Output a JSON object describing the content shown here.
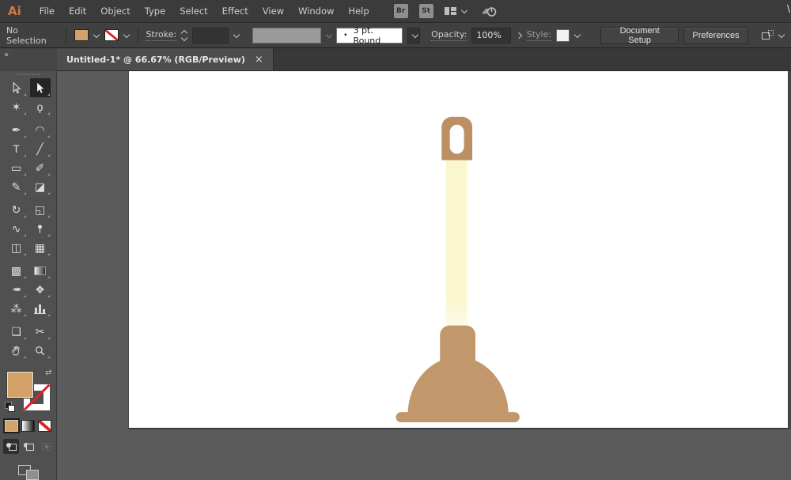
{
  "menu_bar": {
    "logo": "Ai",
    "items": [
      "File",
      "Edit",
      "Object",
      "Type",
      "Select",
      "Effect",
      "View",
      "Window",
      "Help"
    ],
    "bridge_button": "Br",
    "stock_button": "St",
    "cutoff_glyph": "\\"
  },
  "control_bar": {
    "selection_status": "No Selection",
    "fill_color": "#D2A269",
    "stroke_label": "Stroke:",
    "brush_dot": "•",
    "brush_definition": "3 pt. Round",
    "opacity_label": "Opacity:",
    "opacity_value": "100%",
    "style_label": "Style:",
    "document_setup_button": "Document Setup",
    "preferences_button": "Preferences"
  },
  "tab_bar": {
    "tab_title": "Untitled-1* @ 66.67% (RGB/Preview)",
    "close_glyph": "×"
  },
  "toolbar": {
    "collapse_glyph": "«",
    "swap_glyph": "⇄",
    "fill_color": "#D2A269",
    "stroke_style": "none",
    "tool_groups": [
      [
        {
          "name": "selection-tool",
          "icon": "arrow-outline"
        },
        {
          "name": "direct-selection-tool",
          "icon": "arrow-filled",
          "active": true
        },
        {
          "name": "magic-wand-tool",
          "glyph": "✶"
        },
        {
          "name": "lasso-tool",
          "glyph": "ϙ"
        }
      ],
      [
        {
          "name": "pen-tool",
          "glyph": "✒"
        },
        {
          "name": "curvature-tool",
          "glyph": "◠"
        },
        {
          "name": "type-tool",
          "glyph": "T"
        },
        {
          "name": "line-segment-tool",
          "glyph": "╱"
        },
        {
          "name": "rectangle-tool",
          "glyph": "▭"
        },
        {
          "name": "paintbrush-tool",
          "glyph": "✐"
        },
        {
          "name": "shaper-tool",
          "glyph": "✎"
        },
        {
          "name": "eraser-tool",
          "glyph": "◪"
        }
      ],
      [
        {
          "name": "rotate-tool",
          "glyph": "↻"
        },
        {
          "name": "scale-tool",
          "glyph": "◱"
        },
        {
          "name": "width-tool",
          "glyph": "∿"
        },
        {
          "name": "puppet-warp-tool",
          "icon": "pin"
        },
        {
          "name": "shape-builder-tool",
          "glyph": "◫"
        },
        {
          "name": "perspective-grid-tool",
          "glyph": "▦"
        }
      ],
      [
        {
          "name": "mesh-tool",
          "glyph": "▩"
        },
        {
          "name": "gradient-tool",
          "icon": "gradient-box"
        },
        {
          "name": "eyedropper-tool",
          "glyph": "✒",
          "flip": true
        },
        {
          "name": "blend-tool",
          "glyph": "❖"
        },
        {
          "name": "symbol-sprayer-tool",
          "glyph": "⁂"
        },
        {
          "name": "column-graph-tool",
          "icon": "bars"
        }
      ],
      [
        {
          "name": "artboard-tool",
          "glyph": "❏"
        },
        {
          "name": "slice-tool",
          "glyph": "✂"
        },
        {
          "name": "hand-tool",
          "icon": "hand"
        },
        {
          "name": "zoom-tool",
          "icon": "magnifier"
        }
      ]
    ]
  },
  "artwork": {
    "subject": "plunger",
    "knob_color": "#BD9064",
    "cup_color": "#C2976B",
    "shaft_color": "#FAF6CD",
    "hole_color": "#FFFFFF"
  }
}
